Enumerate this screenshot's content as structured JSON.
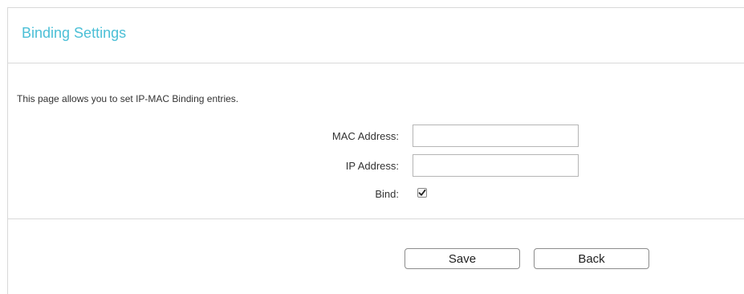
{
  "header": {
    "title": "Binding Settings"
  },
  "description": "This page allows you to set IP-MAC Binding entries.",
  "form": {
    "mac_label": "MAC Address:",
    "mac_value": "",
    "ip_label": "IP Address:",
    "ip_value": "",
    "bind_label": "Bind:",
    "bind_checked": true
  },
  "actions": {
    "save_label": "Save",
    "back_label": "Back"
  },
  "icons": {
    "checkmark": "checkmark-icon"
  }
}
